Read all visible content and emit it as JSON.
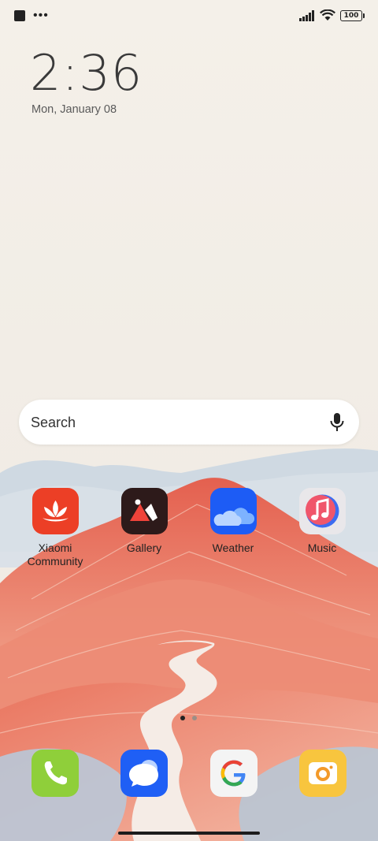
{
  "status_bar": {
    "battery": "100",
    "icons": [
      "notification-square-icon",
      "more-dots-icon",
      "signal-icon",
      "wifi-icon",
      "battery-icon"
    ]
  },
  "clock": {
    "time": "2:36",
    "date": "Mon, January 08"
  },
  "search": {
    "placeholder": "Search",
    "mic_icon": "microphone-icon"
  },
  "apps": [
    {
      "label": "Xiaomi\nCommunity",
      "icon": "xiaomi-community-icon",
      "color": "#ec3f26"
    },
    {
      "label": "Gallery",
      "icon": "gallery-icon",
      "color": "#2d1a1a"
    },
    {
      "label": "Weather",
      "icon": "weather-icon",
      "color": "#1d5cf5"
    },
    {
      "label": "Music",
      "icon": "music-icon",
      "color": "#e9e7ea"
    }
  ],
  "dock": [
    {
      "name": "Phone",
      "icon": "phone-icon",
      "color": "#8fcf3a"
    },
    {
      "name": "Messages",
      "icon": "messages-icon",
      "color": "#1f5ff5"
    },
    {
      "name": "Google",
      "icon": "google-icon",
      "color": "#f4f4f4"
    },
    {
      "name": "Camera",
      "icon": "camera-icon",
      "color": "#f8c53e"
    }
  ],
  "pager": {
    "pages": 2,
    "current": 1
  }
}
